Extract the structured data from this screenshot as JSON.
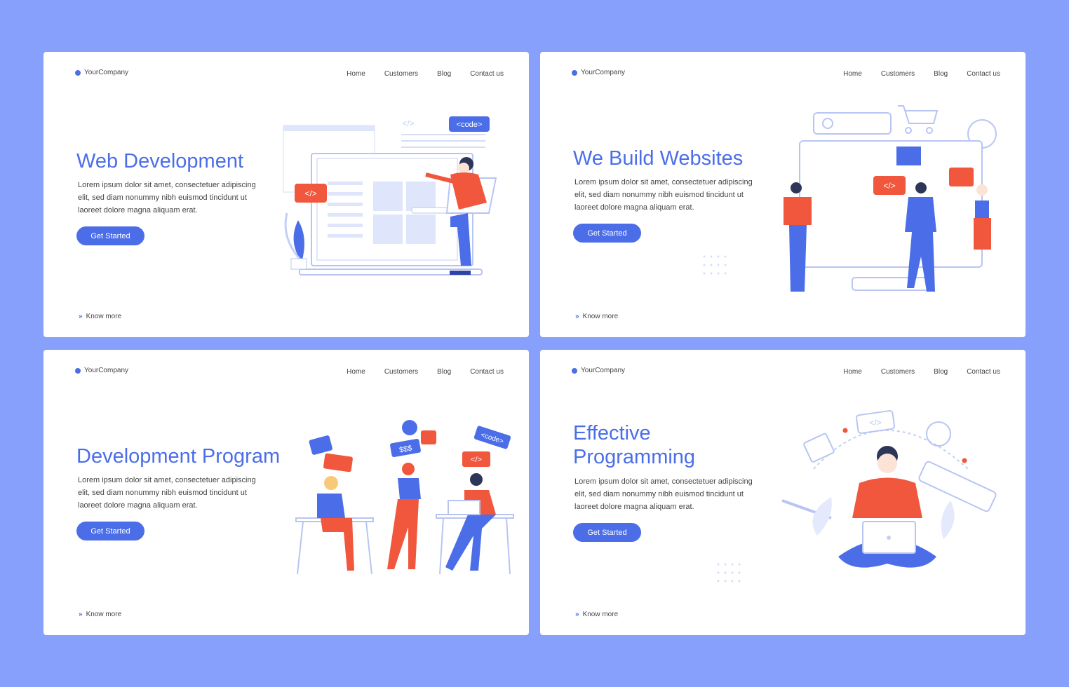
{
  "colors": {
    "background": "#86a0fb",
    "accent": "#4b6ee8",
    "secondary": "#f0573c",
    "card": "#ffffff"
  },
  "cards": [
    {
      "logo": "YourCompany",
      "nav": [
        "Home",
        "Customers",
        "Blog",
        "Contact us"
      ],
      "title": "Web Development",
      "title2": "",
      "body": "Lorem ipsum dolor sit amet, consectetuer adipiscing elit, sed diam nonummy nibh euismod tincidunt ut laoreet dolore magna aliquam erat.",
      "button": "Get Started",
      "know_more": "Know more",
      "tags": [
        "<code>",
        "</>",
        "</>"
      ]
    },
    {
      "logo": "YourCompany",
      "nav": [
        "Home",
        "Customers",
        "Blog",
        "Contact us"
      ],
      "title": "We Build Websites",
      "title2": "",
      "body": "Lorem ipsum dolor sit amet, consectetuer adipiscing elit, sed diam nonummy nibh euismod tincidunt ut laoreet dolore magna aliquam erat.",
      "button": "Get Started",
      "know_more": "Know more",
      "tags": [
        "</>"
      ]
    },
    {
      "logo": "YourCompany",
      "nav": [
        "Home",
        "Customers",
        "Blog",
        "Contact us"
      ],
      "title": "Development Program",
      "title2": "",
      "body": "Lorem ipsum dolor sit amet, consectetuer adipiscing elit, sed diam nonummy nibh euismod tincidunt ut laoreet dolore magna aliquam erat.",
      "button": "Get Started",
      "know_more": "Know more",
      "tags": [
        "$$$",
        "</>",
        "<code>"
      ]
    },
    {
      "logo": "YourCompany",
      "nav": [
        "Home",
        "Customers",
        "Blog",
        "Contact us"
      ],
      "title": "Effective",
      "title2": "Programming",
      "body": "Lorem ipsum dolor sit amet, consectetuer adipiscing elit, sed diam nonummy nibh euismod tincidunt ut laoreet dolore magna aliquam erat.",
      "button": "Get Started",
      "know_more": "Know more",
      "tags": [
        "</>"
      ]
    }
  ]
}
